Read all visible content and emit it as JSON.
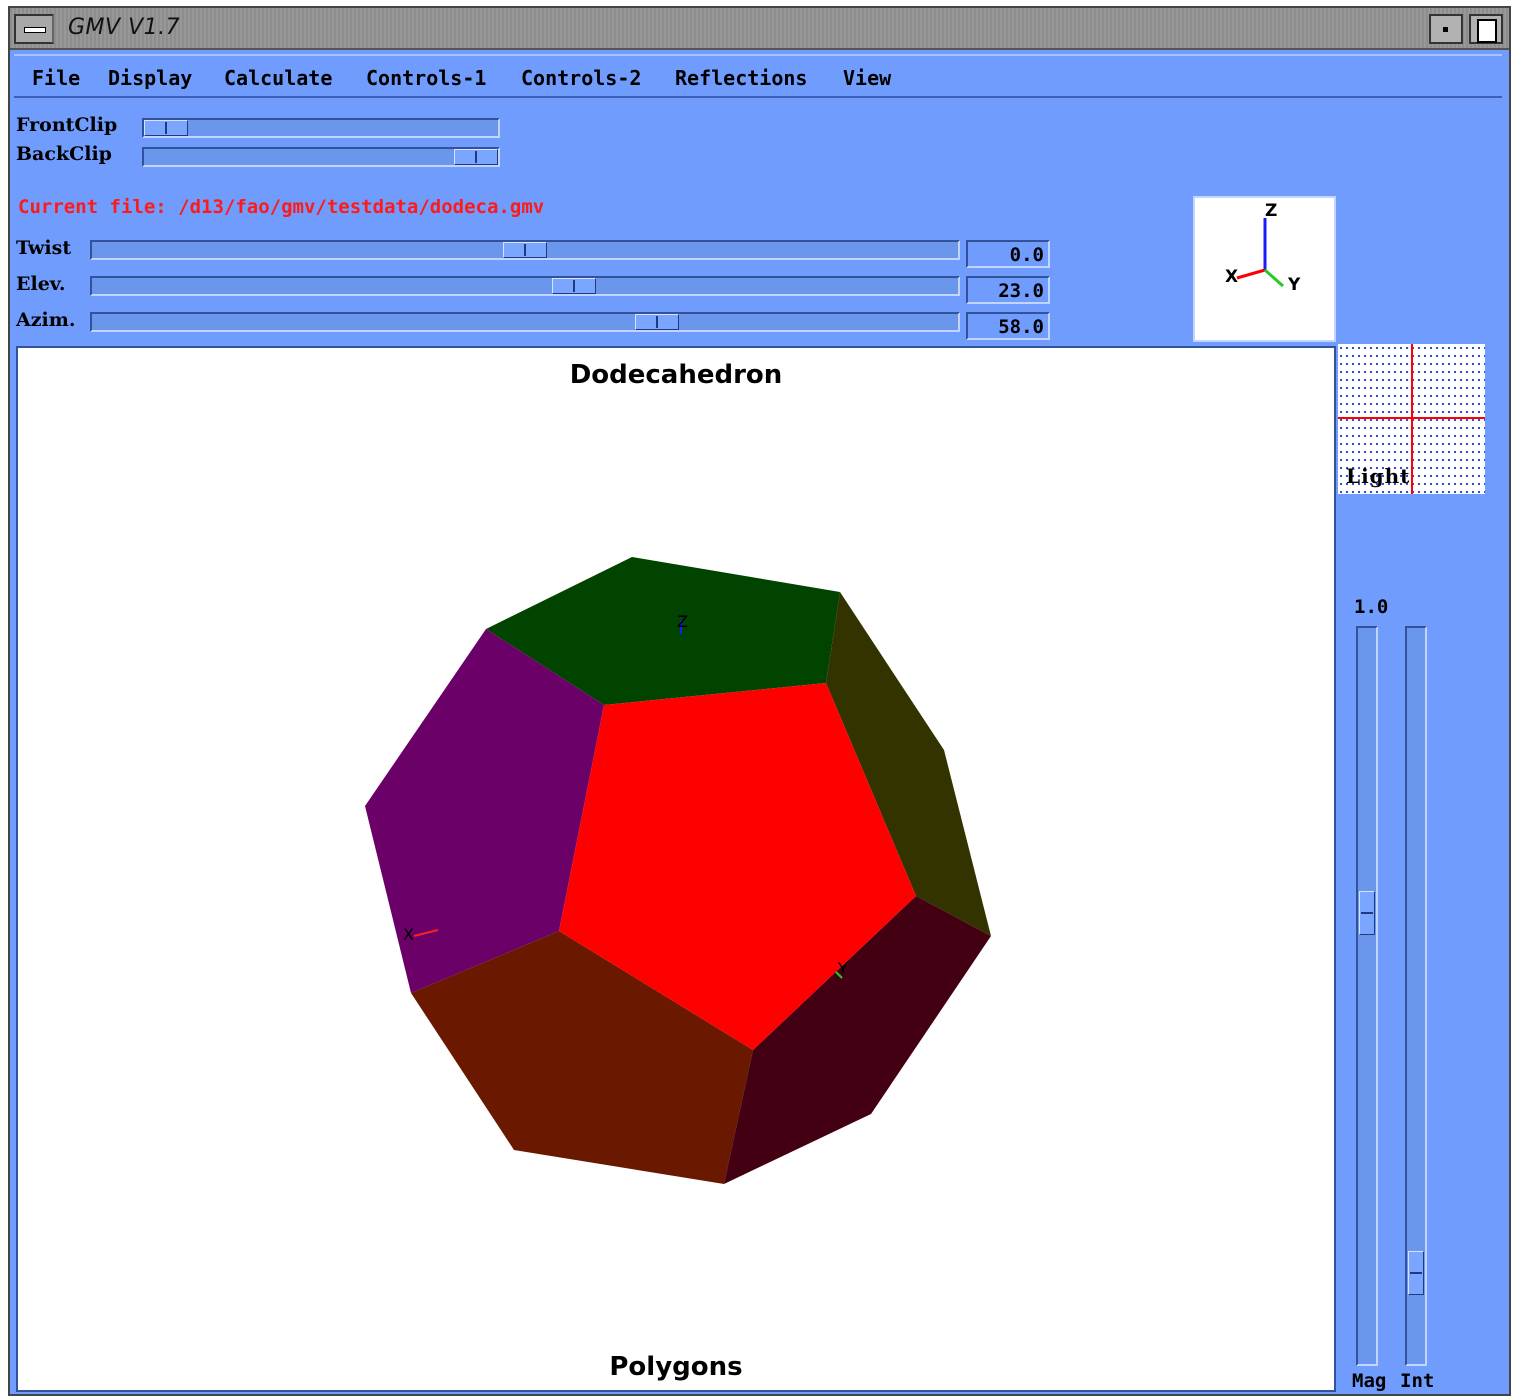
{
  "window": {
    "title": "GMV V1.7"
  },
  "menu": [
    "File",
    "Display",
    "Calculate",
    "Controls-1",
    "Controls-2",
    "Reflections",
    "View"
  ],
  "clip": {
    "front_label": "FrontClip",
    "back_label": "BackClip",
    "front_level": 0.0,
    "back_level": 1.0
  },
  "current_file": "Current file: /d13/fao/gmv/testdata/dodeca.gmv",
  "rotation": {
    "twist_label": "Twist",
    "twist_value": "0.0",
    "twist_level": 0.5,
    "elev_label": "Elev.",
    "elev_value": "23.0",
    "elev_level": 0.56,
    "azim_label": "Azim.",
    "azim_value": "58.0",
    "azim_level": 0.66
  },
  "axes_widget": {
    "x": "X",
    "y": "Y",
    "z": "Z"
  },
  "viewport": {
    "title": "Dodecahedron",
    "subtitle": "Polygons",
    "face_colors": {
      "top": "#004400",
      "left": "#6a0068",
      "front": "#ff0000",
      "right": "#333300",
      "bottom_left": "#6a1800",
      "bottom_right": "#440013"
    },
    "axis_x": "X",
    "axis_y": "Y",
    "axis_z": "Z"
  },
  "light": {
    "label": "Light"
  },
  "magnify": {
    "value": "1.0",
    "mag_label": "Mag",
    "int_label": "Int",
    "mag_level": 0.62,
    "int_level": 0.1
  },
  "colors": {
    "panel": "#6f9cfd",
    "file_text": "#ff1a1a"
  }
}
